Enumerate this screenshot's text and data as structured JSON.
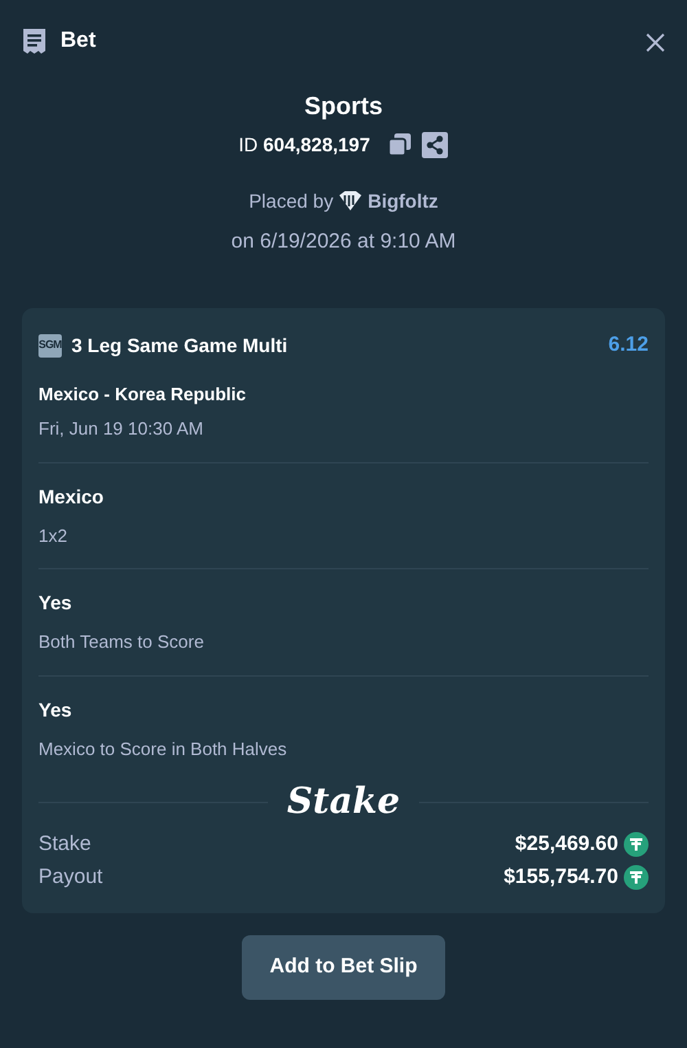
{
  "window": {
    "title": "Bet"
  },
  "summary": {
    "category": "Sports",
    "id_label": "ID",
    "id_value": "604,828,197",
    "placed_by_label": "Placed by",
    "user": "Bigfoltz",
    "placed_on": "on 6/19/2026 at 9:10 AM"
  },
  "bet": {
    "badge": "SGM",
    "title": "3 Leg Same Game Multi",
    "odds": "6.12",
    "event": "Mexico - Korea Republic",
    "event_time": "Fri, Jun 19 10:30 AM",
    "legs": [
      {
        "selection": "Mexico",
        "market": "1x2"
      },
      {
        "selection": "Yes",
        "market": "Both Teams to Score"
      },
      {
        "selection": "Yes",
        "market": "Mexico to Score in Both Halves"
      }
    ],
    "brand": "Stake",
    "amounts": [
      {
        "label": "Stake",
        "value": "$25,469.60"
      },
      {
        "label": "Payout",
        "value": "$155,754.70"
      }
    ]
  },
  "button": "Add to Bet Slip"
}
